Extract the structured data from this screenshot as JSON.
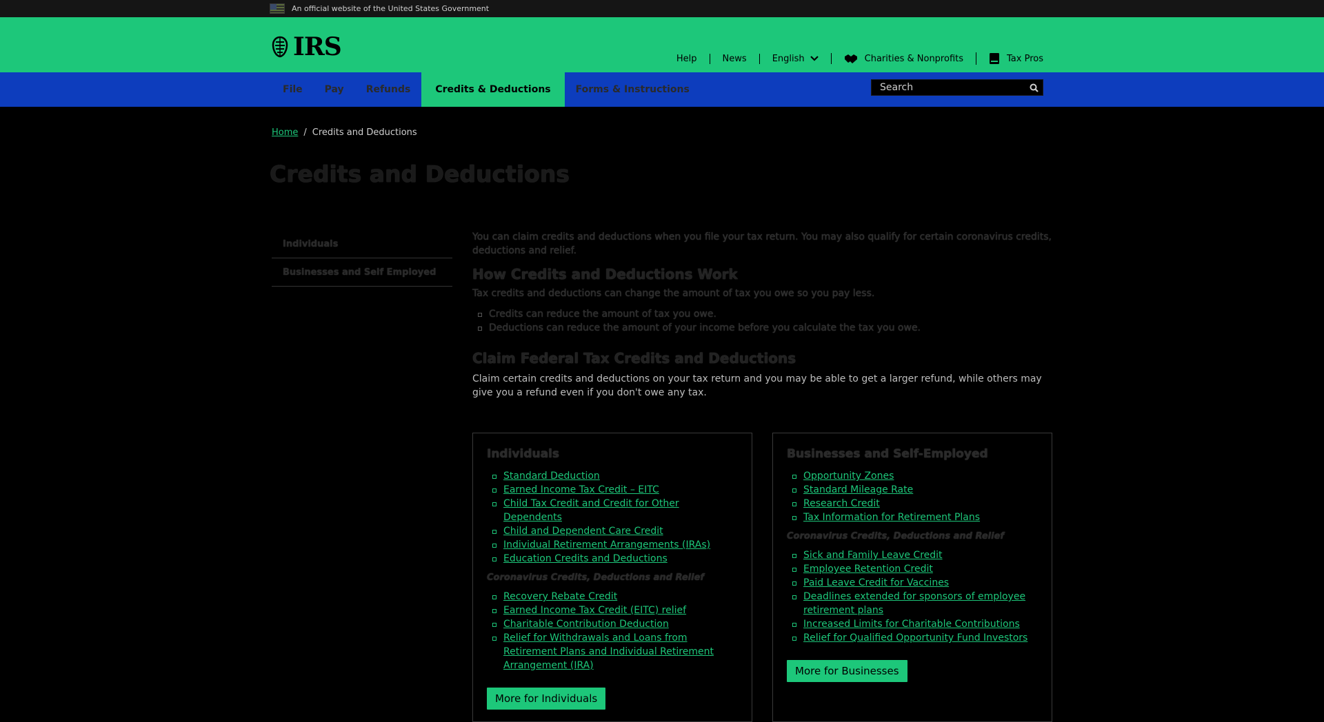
{
  "gov_banner": {
    "text": "An official website of the United States Government"
  },
  "header": {
    "logo_text": "IRS",
    "utility": {
      "help": "Help",
      "news": "News",
      "language": "English",
      "charities": "Charities & Nonprofits",
      "tax_pros": "Tax Pros"
    }
  },
  "nav": {
    "items": [
      {
        "label": "File"
      },
      {
        "label": "Pay"
      },
      {
        "label": "Refunds"
      },
      {
        "label": "Credits & Deductions"
      },
      {
        "label": "Forms & Instructions"
      }
    ],
    "active_index": 3,
    "search_placeholder": "Search"
  },
  "breadcrumb": {
    "home": "Home",
    "separator": "/",
    "current": "Credits and Deductions"
  },
  "page_title": "Credits and Deductions",
  "sidenav": {
    "items": [
      "Individuals",
      "Businesses and Self Employed"
    ]
  },
  "content": {
    "intro": "You can claim credits and deductions when you file your tax return. You may also qualify for certain coronavirus credits, deductions and relief.",
    "how_heading": "How Credits and Deductions Work",
    "how_text": "Tax credits and deductions can change the amount of tax you owe so you pay less.",
    "how_bullets": [
      "Credits can reduce the amount of tax you owe.",
      "Deductions can reduce the amount of your income before you calculate the tax you owe."
    ],
    "claim_heading": "Claim Federal Tax Credits and Deductions",
    "claim_text": "Claim certain credits and deductions on your tax return and you may be able to get a larger refund, while others may give you a refund even if you don't owe any tax."
  },
  "cards": {
    "individuals": {
      "title": "Individuals",
      "links": [
        "Standard Deduction",
        "Earned Income Tax Credit – EITC",
        "Child Tax Credit and Credit for Other Dependents",
        "Child and Dependent Care Credit",
        "Individual Retirement Arrangements (IRAs)",
        "Education Credits and Deductions"
      ],
      "subheading": "Coronavirus Credits, Deductions and Relief",
      "covid_links": [
        "Recovery Rebate Credit",
        "Earned Income Tax Credit (EITC) relief",
        "Charitable Contribution Deduction",
        "Relief for Withdrawals and Loans from Retirement Plans and Individual Retirement Arrangement (IRA)"
      ],
      "button": "More for Individuals"
    },
    "businesses": {
      "title": "Businesses and Self-Employed",
      "links": [
        "Opportunity Zones",
        "Standard Mileage Rate",
        "Research Credit",
        "Tax Information for Retirement Plans"
      ],
      "subheading": "Coronavirus Credits, Deductions and Relief",
      "covid_links": [
        "Sick and Family Leave Credit",
        "Employee Retention Credit",
        "Paid Leave Credit for Vaccines",
        "Deadlines extended for sponsors of employee retirement plans",
        "Increased Limits for Charitable Contributions",
        "Relief for Qualified Opportunity Fund Investors"
      ],
      "button": "More for Businesses"
    }
  },
  "colors": {
    "header_green": "#1dc77a",
    "nav_blue": "#0d3dbd",
    "link_green": "#1dc77a"
  }
}
